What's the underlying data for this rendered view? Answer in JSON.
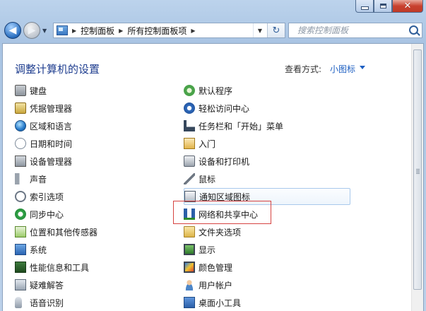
{
  "window": {
    "controls": [
      "minimize-icon",
      "maximize-icon",
      "close-icon"
    ],
    "close_glyph": "✕"
  },
  "navigation": {
    "back_icon": "back-arrow-icon",
    "forward_icon": "forward-arrow-icon",
    "breadcrumbs": [
      "控制面板",
      "所有控制面板项"
    ],
    "search_placeholder": "搜索控制面板"
  },
  "header": {
    "title": "调整计算机的设置",
    "view_by_label": "查看方式:",
    "view_by_value": "小图标"
  },
  "items_left": [
    {
      "label": "键盘",
      "icon": "keyboard-icon"
    },
    {
      "label": "凭据管理器",
      "icon": "credential-manager-icon"
    },
    {
      "label": "区域和语言",
      "icon": "region-language-icon"
    },
    {
      "label": "日期和时间",
      "icon": "date-time-icon"
    },
    {
      "label": "设备管理器",
      "icon": "device-manager-icon"
    },
    {
      "label": "声音",
      "icon": "sound-icon"
    },
    {
      "label": "索引选项",
      "icon": "indexing-options-icon"
    },
    {
      "label": "同步中心",
      "icon": "sync-center-icon"
    },
    {
      "label": "位置和其他传感器",
      "icon": "location-sensors-icon"
    },
    {
      "label": "系统",
      "icon": "system-icon"
    },
    {
      "label": "性能信息和工具",
      "icon": "performance-icon"
    },
    {
      "label": "疑难解答",
      "icon": "troubleshooting-icon"
    },
    {
      "label": "语音识别",
      "icon": "speech-recognition-icon"
    }
  ],
  "items_right": [
    {
      "label": "默认程序",
      "icon": "default-programs-icon"
    },
    {
      "label": "轻松访问中心",
      "icon": "ease-of-access-icon"
    },
    {
      "label": "任务栏和「开始」菜单",
      "icon": "taskbar-start-menu-icon"
    },
    {
      "label": "入门",
      "icon": "getting-started-icon"
    },
    {
      "label": "设备和打印机",
      "icon": "devices-printers-icon"
    },
    {
      "label": "鼠标",
      "icon": "mouse-icon"
    },
    {
      "label": "通知区域图标",
      "icon": "notification-area-icon"
    },
    {
      "label": "网络和共享中心",
      "icon": "network-sharing-icon"
    },
    {
      "label": "文件夹选项",
      "icon": "folder-options-icon"
    },
    {
      "label": "显示",
      "icon": "display-icon"
    },
    {
      "label": "颜色管理",
      "icon": "color-management-icon"
    },
    {
      "label": "用户帐户",
      "icon": "user-accounts-icon"
    },
    {
      "label": "桌面小工具",
      "icon": "desktop-gadgets-icon"
    }
  ],
  "colors": {
    "title": "#1e3d8f",
    "link": "#1d5fc2",
    "highlight_box": "#d64341",
    "hover_border": "#a9c9ec"
  }
}
